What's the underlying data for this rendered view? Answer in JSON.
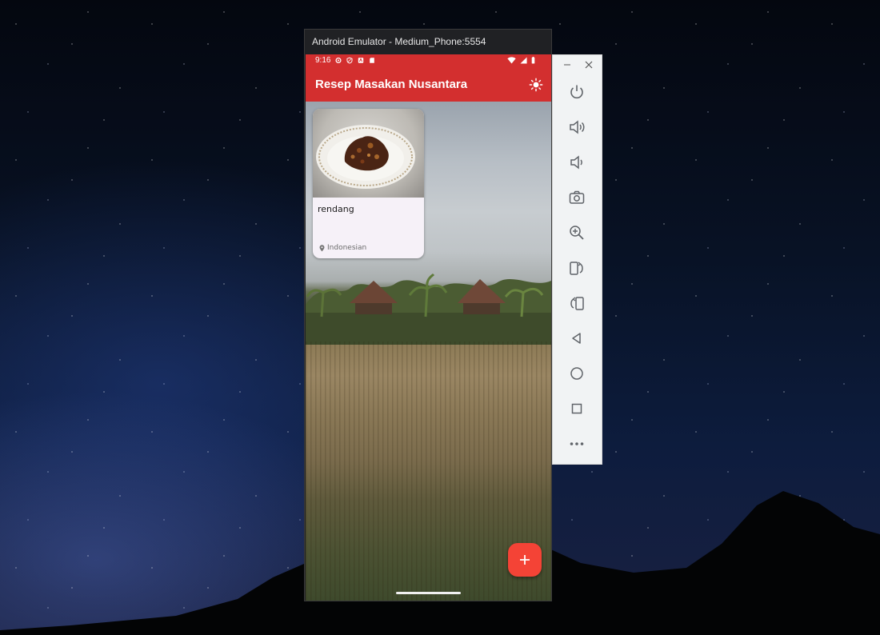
{
  "window": {
    "title": "Android Emulator - Medium_Phone:5554"
  },
  "statusbar": {
    "time": "9:16"
  },
  "app": {
    "title": "Resep Masakan Nusantara",
    "theme_icon": "sun-icon"
  },
  "recipes": [
    {
      "name": "rendang",
      "origin": "Indonesian"
    }
  ],
  "fab": {
    "icon": "plus-icon"
  },
  "toolbar": {
    "items": [
      "power-icon",
      "volume-up-icon",
      "volume-down-icon",
      "camera-icon",
      "zoom-icon",
      "rotate-left-icon",
      "rotate-right-icon",
      "back-icon",
      "home-icon",
      "overview-icon",
      "more-icon"
    ]
  },
  "colors": {
    "app_bar": "#d32f2f",
    "fab": "#f44336",
    "card_bg": "#f6f1f8"
  }
}
